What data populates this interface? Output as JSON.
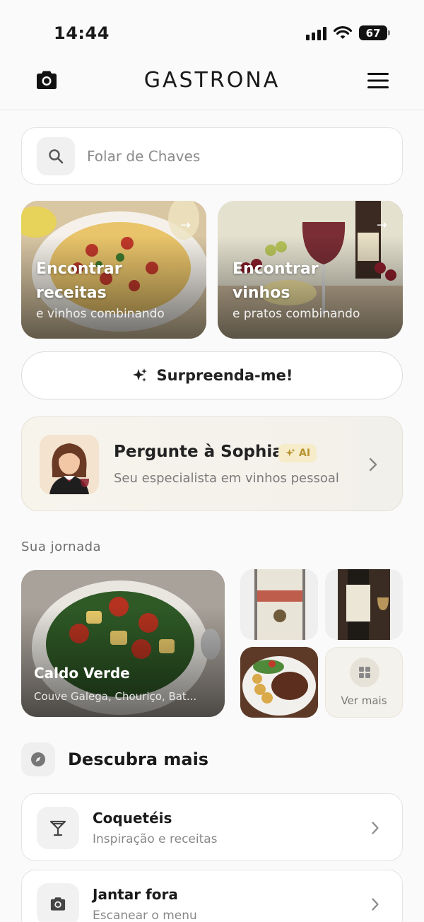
{
  "status_bar": {
    "time": "14:44",
    "battery": "67",
    "icons": [
      "signal-icon",
      "wifi-icon",
      "battery-icon"
    ]
  },
  "header": {
    "title": "GASTRONA",
    "left_icon": "camera-icon",
    "right_icon": "menu-icon"
  },
  "search": {
    "placeholder": "Folar de Chaves",
    "icon": "search-icon"
  },
  "feature_cards": [
    {
      "title": "Encontrar receitas",
      "subtitle": "e vinhos combinando",
      "icon": "arrow-right-icon"
    },
    {
      "title": "Encontrar vinhos",
      "subtitle": "e pratos combinando",
      "icon": "arrow-right-icon"
    }
  ],
  "surprise": {
    "label": "Surpreenda-me!",
    "icon": "sparkles-icon"
  },
  "sophia": {
    "title": "Pergunte à Sophia",
    "badge": "AI",
    "subtitle": "Seu especialista em vinhos pessoal"
  },
  "journey": {
    "section_label": "Sua jornada",
    "main": {
      "title": "Caldo Verde",
      "subtitle": "Couve Galega, Chouriço, Bat..."
    },
    "see_more_label": "Ver mais"
  },
  "discover": {
    "title": "Descubra mais",
    "icon": "compass-icon",
    "items": [
      {
        "title": "Coquetéis",
        "subtitle": "Inspiração e receitas",
        "icon": "cocktail-icon"
      },
      {
        "title": "Jantar fora",
        "subtitle": "Escanear o menu",
        "icon": "camera-icon"
      }
    ]
  },
  "colors": {
    "background": "#fafafa",
    "ai_badge": "#b8922e",
    "text": "#1a1a1a"
  }
}
